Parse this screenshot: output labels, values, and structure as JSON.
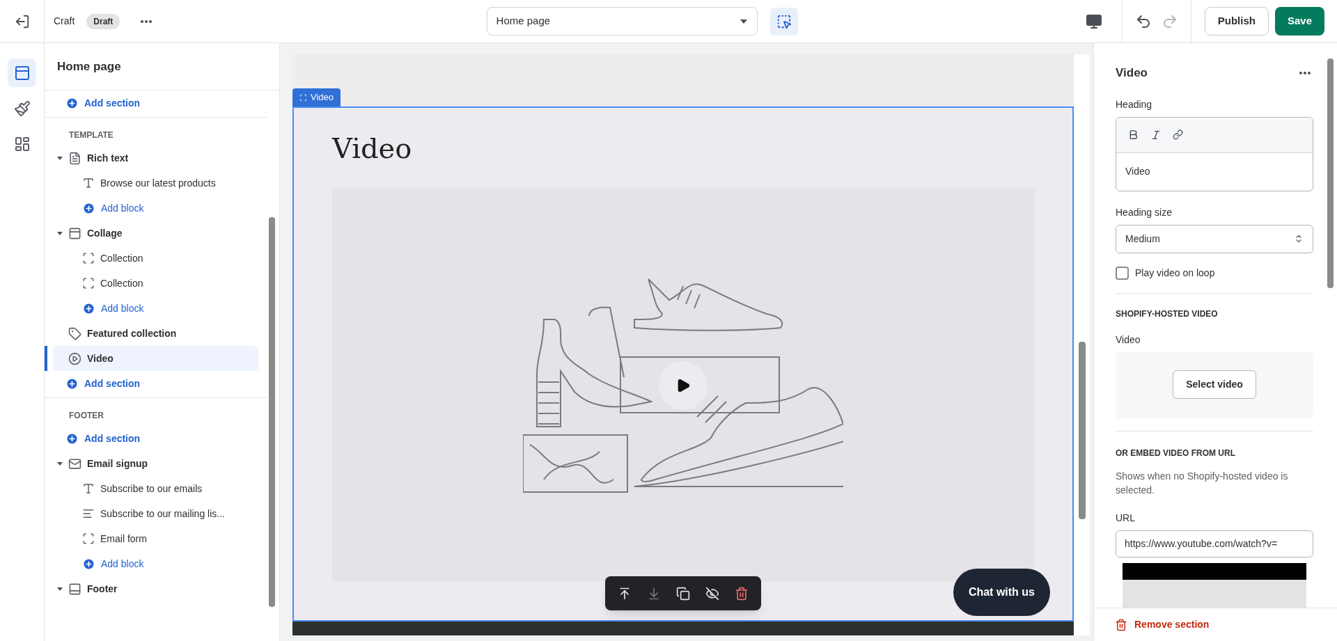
{
  "topbar": {
    "theme_name": "Craft",
    "badge": "Draft",
    "page_select": "Home page",
    "inspector_selected": true,
    "redo_disabled": true,
    "publish": "Publish",
    "save": "Save"
  },
  "rail": [
    {
      "kind": "sections",
      "selected": true
    },
    {
      "kind": "theme",
      "selected": false
    },
    {
      "kind": "apps",
      "selected": false
    }
  ],
  "sidebar": {
    "title": "Home page",
    "groups": [
      {
        "items": [
          {
            "kind": "add_section",
            "label": "Add section"
          }
        ]
      },
      {
        "label": "TEMPLATE",
        "items": [
          {
            "kind": "rich_text",
            "label": "Rich text",
            "expanded": true,
            "selected": false,
            "children": [
              {
                "kind": "heading",
                "label": "Browse our latest products"
              },
              {
                "kind": "add_block",
                "label": "Add block"
              }
            ]
          },
          {
            "kind": "collage",
            "label": "Collage",
            "expanded": true,
            "selected": false,
            "children": [
              {
                "kind": "placeholder",
                "label": "Collection"
              },
              {
                "kind": "placeholder",
                "label": "Collection"
              },
              {
                "kind": "add_block",
                "label": "Add block"
              }
            ]
          },
          {
            "kind": "featured",
            "label": "Featured collection",
            "selected": false
          },
          {
            "kind": "video",
            "label": "Video",
            "selected": true
          },
          {
            "kind": "add_section",
            "label": "Add section"
          }
        ]
      },
      {
        "label": "FOOTER",
        "items": [
          {
            "kind": "add_section",
            "label": "Add section"
          },
          {
            "kind": "email",
            "label": "Email signup",
            "expanded": true,
            "selected": false,
            "children": [
              {
                "kind": "heading",
                "label": "Subscribe to our emails"
              },
              {
                "kind": "paragraph",
                "label": "Subscribe to our mailing lis..."
              },
              {
                "kind": "placeholder",
                "label": "Email form"
              },
              {
                "kind": "add_block",
                "label": "Add block"
              }
            ]
          },
          {
            "kind": "footer",
            "label": "Footer",
            "expanded": true,
            "selected": false
          }
        ]
      }
    ]
  },
  "preview": {
    "tag": "Video",
    "heading": "Video",
    "chat": "Chat with us"
  },
  "panel": {
    "title": "Video",
    "heading_label": "Heading",
    "heading_value": "Video",
    "size_label": "Heading size",
    "size_value": "Medium",
    "loop_label": "Play video on loop",
    "loop_checked": false,
    "hosted_title": "SHOPIFY-HOSTED VIDEO",
    "video_label": "Video",
    "select_button": "Select video",
    "embed_title": "OR EMBED VIDEO FROM URL",
    "embed_help": "Shows when no Shopify-hosted video is selected.",
    "url_label": "URL",
    "url_value": "https://www.youtube.com/watch?v=",
    "remove": "Remove section"
  }
}
